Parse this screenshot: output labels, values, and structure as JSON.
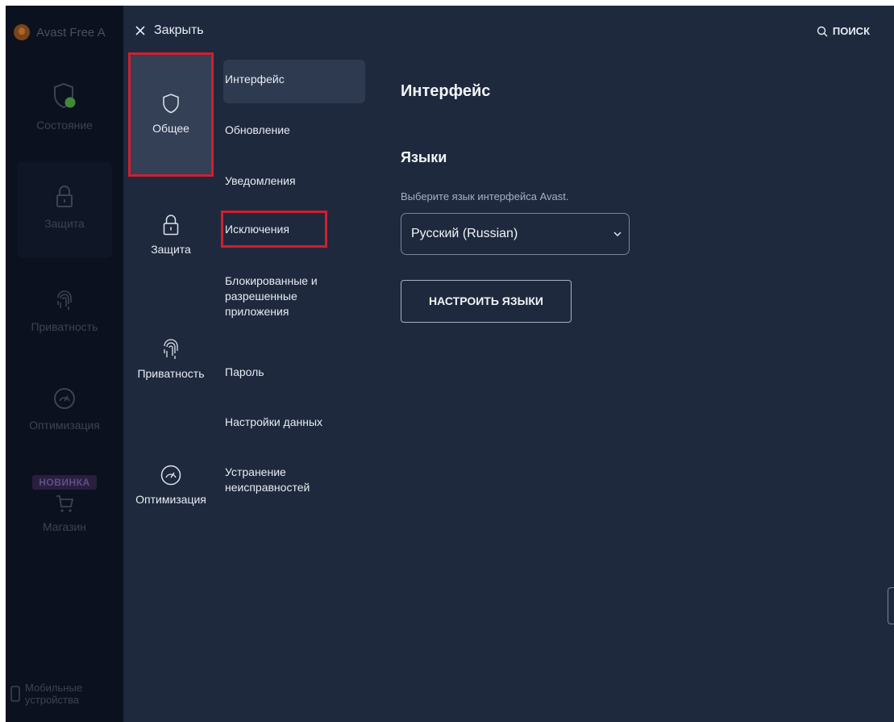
{
  "app": {
    "title": "Avast Free A"
  },
  "background_nav": {
    "items": [
      {
        "label": "Состояние",
        "icon": "shield-check-icon"
      },
      {
        "label": "Защита",
        "icon": "lock-icon",
        "selected": true
      },
      {
        "label": "Приватность",
        "icon": "fingerprint-icon"
      },
      {
        "label": "Оптимизация",
        "icon": "speedometer-icon"
      },
      {
        "label": "Магазин",
        "icon": "cart-icon",
        "badge": "НОВИНКА"
      }
    ],
    "mobile_label_1": "Мобильные",
    "mobile_label_2": "устройства"
  },
  "settings": {
    "close_label": "Закрыть",
    "search_label": "ПОИСК",
    "categories": [
      {
        "label": "Общее",
        "icon": "shield-icon",
        "selected": true
      },
      {
        "label": "Защита",
        "icon": "lock-icon"
      },
      {
        "label": "Приватность",
        "icon": "fingerprint-icon"
      },
      {
        "label": "Оптимизация",
        "icon": "speedometer-icon"
      }
    ],
    "subsections": [
      {
        "label": "Интерфейс",
        "active": true
      },
      {
        "label": "Обновление"
      },
      {
        "label": "Уведомления"
      },
      {
        "label": "Исключения",
        "highlighted": true
      },
      {
        "label_lines": [
          "Блокированные и",
          "разрешенные",
          "приложения"
        ]
      },
      {
        "label": "Пароль"
      },
      {
        "label": "Настройки данных"
      },
      {
        "label_lines": [
          "Устранение",
          "неисправностей"
        ]
      }
    ],
    "content": {
      "heading": "Интерфейс",
      "section_heading": "Языки",
      "description": "Выберите язык интерфейса Avast.",
      "language_selected": "Русский (Russian)",
      "configure_button": "НАСТРОИТЬ ЯЗЫКИ"
    }
  },
  "colors": {
    "overlay_bg": "#1e293d",
    "selected_category_bg": "#334056",
    "highlight_border": "#d11f2e",
    "text": "#e8ecf3"
  }
}
